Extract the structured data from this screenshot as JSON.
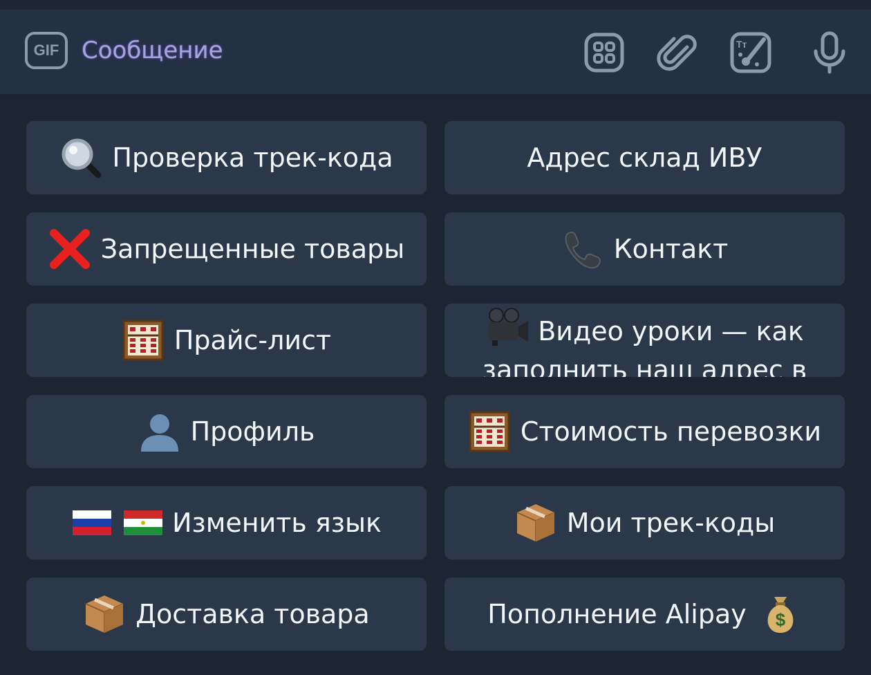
{
  "composer": {
    "gif_label": "GIF",
    "placeholder": "Сообщение",
    "icons": [
      "grid-icon",
      "paperclip-icon",
      "sticker-brush-icon",
      "microphone-icon"
    ]
  },
  "keyboard": {
    "rows": [
      {
        "left": {
          "emoji": "magnifier-icon",
          "label": "Проверка трек-кода"
        },
        "right": {
          "emoji": "",
          "label": "Адрес склад  ИВУ"
        }
      },
      {
        "left": {
          "emoji": "cross-mark-icon",
          "label": "Запрещенные товары"
        },
        "right": {
          "emoji": "phone-icon",
          "label": "Контакт"
        }
      },
      {
        "left": {
          "emoji": "abacus-icon",
          "label": "Прайс-лист"
        },
        "right": {
          "emoji": "movie-camera-icon",
          "label": "Видео уроки — как заполнить наш  адрес в"
        }
      },
      {
        "left": {
          "emoji": "person-icon",
          "label": "Профиль"
        },
        "right": {
          "emoji": "abacus-icon",
          "label": "Стоимость перевозки"
        }
      },
      {
        "left": {
          "emoji": "flags-icon",
          "label": "Изменить язык"
        },
        "right": {
          "emoji": "package-icon",
          "label": "Мои трек-коды"
        }
      },
      {
        "left": {
          "emoji": "package-icon",
          "label": "Доставка товара"
        },
        "right": {
          "emoji": "money-bag-icon",
          "label": "Пополнение Alipay"
        }
      }
    ]
  },
  "colors": {
    "background": "#1c2532",
    "composer_bg": "#243142",
    "button_bg": "#2b3849",
    "icon_gray": "#8e9aa9",
    "text": "#f3f6fa"
  }
}
